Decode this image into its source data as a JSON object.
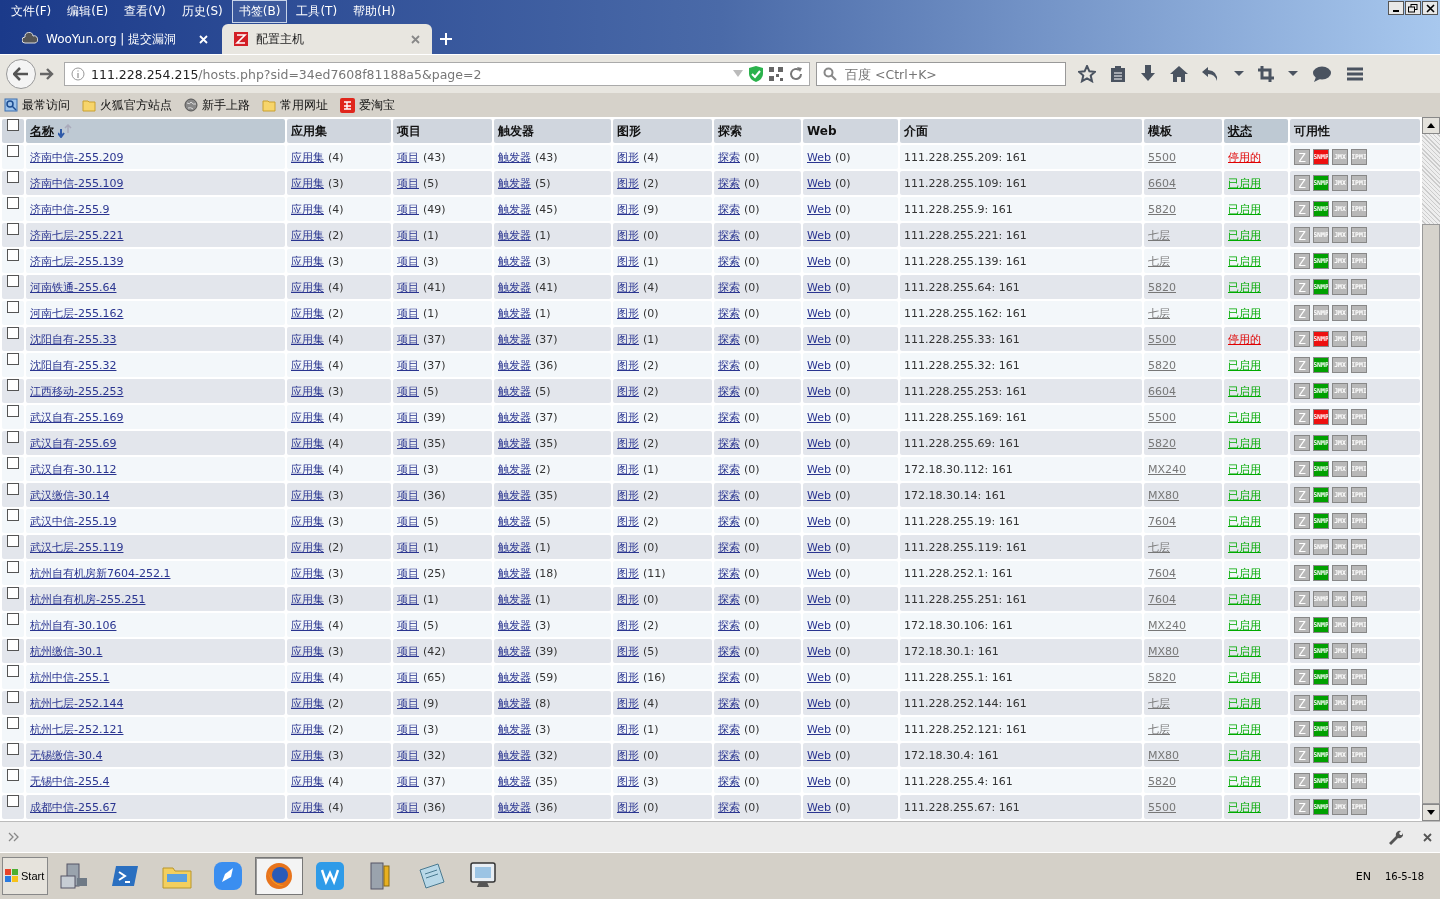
{
  "menu": [
    {
      "label": "文件(F)",
      "selected": false
    },
    {
      "label": "编辑(E)",
      "selected": false
    },
    {
      "label": "查看(V)",
      "selected": false
    },
    {
      "label": "历史(S)",
      "selected": false
    },
    {
      "label": "书签(B)",
      "selected": true
    },
    {
      "label": "工具(T)",
      "selected": false
    },
    {
      "label": "帮助(H)",
      "selected": false
    }
  ],
  "tabs": [
    {
      "title": "WooYun.org | 提交漏洞",
      "selected": false,
      "kind": "cloud"
    },
    {
      "title": "配置主机",
      "selected": true,
      "kind": "zabbix"
    }
  ],
  "address": {
    "host": "111.228.254.215",
    "path": "/hosts.php?sid=34ed7608f81188a5&page=2"
  },
  "search": {
    "placeholder": "百度 <Ctrl+K>"
  },
  "bookmarks": [
    {
      "label": "最常访问",
      "kind": "smart"
    },
    {
      "label": "火狐官方站点",
      "kind": "folder"
    },
    {
      "label": "新手上路",
      "kind": "globe"
    },
    {
      "label": "常用网址",
      "kind": "folder"
    },
    {
      "label": "爱淘宝",
      "kind": "taobao"
    }
  ],
  "table": {
    "header_checked": false,
    "columns": [
      {
        "label": "名称",
        "sortable": true,
        "sorted": true
      },
      {
        "label": "应用集",
        "sortable": false,
        "sorted": false
      },
      {
        "label": "项目",
        "sortable": false,
        "sorted": false
      },
      {
        "label": "触发器",
        "sortable": false,
        "sorted": false
      },
      {
        "label": "图形",
        "sortable": false,
        "sorted": false
      },
      {
        "label": "探索",
        "sortable": false,
        "sorted": false
      },
      {
        "label": "Web",
        "sortable": false,
        "sorted": false
      },
      {
        "label": "介面",
        "sortable": false,
        "sorted": false
      },
      {
        "label": "模板",
        "sortable": false,
        "sorted": false
      },
      {
        "label": "状态",
        "sortable": true,
        "sorted": false
      },
      {
        "label": "可用性",
        "sortable": false,
        "sorted": false
      }
    ],
    "rows": [
      {
        "name": "济南中信-255.209",
        "checked": false,
        "links": [
          [
            "应用集",
            "(4)"
          ],
          [
            "项目",
            "(43)"
          ],
          [
            "触发器",
            "(43)"
          ],
          [
            "图形",
            "(4)"
          ],
          [
            "探索",
            "(0)"
          ],
          [
            "Web",
            "(0)"
          ]
        ],
        "interface": "111.228.255.209: 161",
        "template": "5500",
        "status": {
          "label": "停用的",
          "enabled": false
        },
        "availability": [
          {
            "label": "Z",
            "color": "#b8b8b8"
          },
          {
            "label": "SNMP",
            "color": "#ee1010"
          },
          {
            "label": "JMX",
            "color": "#b8b8b8"
          },
          {
            "label": "IPMI",
            "color": "#b8b8b8"
          }
        ]
      },
      {
        "name": "济南中信-255.109",
        "checked": false,
        "links": [
          [
            "应用集",
            "(3)"
          ],
          [
            "项目",
            "(5)"
          ],
          [
            "触发器",
            "(5)"
          ],
          [
            "图形",
            "(2)"
          ],
          [
            "探索",
            "(0)"
          ],
          [
            "Web",
            "(0)"
          ]
        ],
        "interface": "111.228.255.109: 161",
        "template": "6604",
        "status": {
          "label": "已启用",
          "enabled": true
        },
        "availability": [
          {
            "label": "Z",
            "color": "#b8b8b8"
          },
          {
            "label": "SNMP",
            "color": "#00a000"
          },
          {
            "label": "JMX",
            "color": "#b8b8b8"
          },
          {
            "label": "IPMI",
            "color": "#b8b8b8"
          }
        ]
      },
      {
        "name": "济南中信-255.9",
        "checked": false,
        "links": [
          [
            "应用集",
            "(4)"
          ],
          [
            "项目",
            "(49)"
          ],
          [
            "触发器",
            "(45)"
          ],
          [
            "图形",
            "(9)"
          ],
          [
            "探索",
            "(0)"
          ],
          [
            "Web",
            "(0)"
          ]
        ],
        "interface": "111.228.255.9: 161",
        "template": "5820",
        "status": {
          "label": "已启用",
          "enabled": true
        },
        "availability": [
          {
            "label": "Z",
            "color": "#b8b8b8"
          },
          {
            "label": "SNMP",
            "color": "#00a000"
          },
          {
            "label": "JMX",
            "color": "#b8b8b8"
          },
          {
            "label": "IPMI",
            "color": "#b8b8b8"
          }
        ]
      },
      {
        "name": "济南七层-255.221",
        "checked": false,
        "links": [
          [
            "应用集",
            "(2)"
          ],
          [
            "项目",
            "(1)"
          ],
          [
            "触发器",
            "(1)"
          ],
          [
            "图形",
            "(0)"
          ],
          [
            "探索",
            "(0)"
          ],
          [
            "Web",
            "(0)"
          ]
        ],
        "interface": "111.228.255.221: 161",
        "template": "七层",
        "status": {
          "label": "已启用",
          "enabled": true
        },
        "availability": [
          {
            "label": "Z",
            "color": "#b8b8b8"
          },
          {
            "label": "SNMP",
            "color": "#b8b8b8"
          },
          {
            "label": "JMX",
            "color": "#b8b8b8"
          },
          {
            "label": "IPMI",
            "color": "#b8b8b8"
          }
        ]
      },
      {
        "name": "济南七层-255.139",
        "checked": false,
        "links": [
          [
            "应用集",
            "(3)"
          ],
          [
            "项目",
            "(3)"
          ],
          [
            "触发器",
            "(3)"
          ],
          [
            "图形",
            "(1)"
          ],
          [
            "探索",
            "(0)"
          ],
          [
            "Web",
            "(0)"
          ]
        ],
        "interface": "111.228.255.139: 161",
        "template": "七层",
        "status": {
          "label": "已启用",
          "enabled": true
        },
        "availability": [
          {
            "label": "Z",
            "color": "#b8b8b8"
          },
          {
            "label": "SNMP",
            "color": "#00a000"
          },
          {
            "label": "JMX",
            "color": "#b8b8b8"
          },
          {
            "label": "IPMI",
            "color": "#b8b8b8"
          }
        ]
      },
      {
        "name": "河南铁通-255.64",
        "checked": false,
        "links": [
          [
            "应用集",
            "(4)"
          ],
          [
            "项目",
            "(41)"
          ],
          [
            "触发器",
            "(41)"
          ],
          [
            "图形",
            "(4)"
          ],
          [
            "探索",
            "(0)"
          ],
          [
            "Web",
            "(0)"
          ]
        ],
        "interface": "111.228.255.64: 161",
        "template": "5820",
        "status": {
          "label": "已启用",
          "enabled": true
        },
        "availability": [
          {
            "label": "Z",
            "color": "#b8b8b8"
          },
          {
            "label": "SNMP",
            "color": "#00a000"
          },
          {
            "label": "JMX",
            "color": "#b8b8b8"
          },
          {
            "label": "IPMI",
            "color": "#b8b8b8"
          }
        ]
      },
      {
        "name": "河南七层-255.162",
        "checked": false,
        "links": [
          [
            "应用集",
            "(2)"
          ],
          [
            "项目",
            "(1)"
          ],
          [
            "触发器",
            "(1)"
          ],
          [
            "图形",
            "(0)"
          ],
          [
            "探索",
            "(0)"
          ],
          [
            "Web",
            "(0)"
          ]
        ],
        "interface": "111.228.255.162: 161",
        "template": "七层",
        "status": {
          "label": "已启用",
          "enabled": true
        },
        "availability": [
          {
            "label": "Z",
            "color": "#b8b8b8"
          },
          {
            "label": "SNMP",
            "color": "#b8b8b8"
          },
          {
            "label": "JMX",
            "color": "#b8b8b8"
          },
          {
            "label": "IPMI",
            "color": "#b8b8b8"
          }
        ]
      },
      {
        "name": "沈阳自有-255.33",
        "checked": false,
        "links": [
          [
            "应用集",
            "(4)"
          ],
          [
            "项目",
            "(37)"
          ],
          [
            "触发器",
            "(37)"
          ],
          [
            "图形",
            "(1)"
          ],
          [
            "探索",
            "(0)"
          ],
          [
            "Web",
            "(0)"
          ]
        ],
        "interface": "111.228.255.33: 161",
        "template": "5500",
        "status": {
          "label": "停用的",
          "enabled": false
        },
        "availability": [
          {
            "label": "Z",
            "color": "#b8b8b8"
          },
          {
            "label": "SNMP",
            "color": "#ee1010"
          },
          {
            "label": "JMX",
            "color": "#b8b8b8"
          },
          {
            "label": "IPMI",
            "color": "#b8b8b8"
          }
        ]
      },
      {
        "name": "沈阳自有-255.32",
        "checked": false,
        "links": [
          [
            "应用集",
            "(4)"
          ],
          [
            "项目",
            "(37)"
          ],
          [
            "触发器",
            "(36)"
          ],
          [
            "图形",
            "(2)"
          ],
          [
            "探索",
            "(0)"
          ],
          [
            "Web",
            "(0)"
          ]
        ],
        "interface": "111.228.255.32: 161",
        "template": "5820",
        "status": {
          "label": "已启用",
          "enabled": true
        },
        "availability": [
          {
            "label": "Z",
            "color": "#b8b8b8"
          },
          {
            "label": "SNMP",
            "color": "#00a000"
          },
          {
            "label": "JMX",
            "color": "#b8b8b8"
          },
          {
            "label": "IPMI",
            "color": "#b8b8b8"
          }
        ]
      },
      {
        "name": "江西移动-255.253",
        "checked": false,
        "links": [
          [
            "应用集",
            "(3)"
          ],
          [
            "项目",
            "(5)"
          ],
          [
            "触发器",
            "(5)"
          ],
          [
            "图形",
            "(2)"
          ],
          [
            "探索",
            "(0)"
          ],
          [
            "Web",
            "(0)"
          ]
        ],
        "interface": "111.228.255.253: 161",
        "template": "6604",
        "status": {
          "label": "已启用",
          "enabled": true
        },
        "availability": [
          {
            "label": "Z",
            "color": "#b8b8b8"
          },
          {
            "label": "SNMP",
            "color": "#00a000"
          },
          {
            "label": "JMX",
            "color": "#b8b8b8"
          },
          {
            "label": "IPMI",
            "color": "#b8b8b8"
          }
        ]
      },
      {
        "name": "武汉自有-255.169",
        "checked": false,
        "links": [
          [
            "应用集",
            "(4)"
          ],
          [
            "项目",
            "(39)"
          ],
          [
            "触发器",
            "(37)"
          ],
          [
            "图形",
            "(2)"
          ],
          [
            "探索",
            "(0)"
          ],
          [
            "Web",
            "(0)"
          ]
        ],
        "interface": "111.228.255.169: 161",
        "template": "5500",
        "status": {
          "label": "已启用",
          "enabled": true
        },
        "availability": [
          {
            "label": "Z",
            "color": "#b8b8b8"
          },
          {
            "label": "SNMP",
            "color": "#ee1010"
          },
          {
            "label": "JMX",
            "color": "#b8b8b8"
          },
          {
            "label": "IPMI",
            "color": "#b8b8b8"
          }
        ]
      },
      {
        "name": "武汉自有-255.69",
        "checked": false,
        "links": [
          [
            "应用集",
            "(4)"
          ],
          [
            "项目",
            "(35)"
          ],
          [
            "触发器",
            "(35)"
          ],
          [
            "图形",
            "(2)"
          ],
          [
            "探索",
            "(0)"
          ],
          [
            "Web",
            "(0)"
          ]
        ],
        "interface": "111.228.255.69: 161",
        "template": "5820",
        "status": {
          "label": "已启用",
          "enabled": true
        },
        "availability": [
          {
            "label": "Z",
            "color": "#b8b8b8"
          },
          {
            "label": "SNMP",
            "color": "#00a000"
          },
          {
            "label": "JMX",
            "color": "#b8b8b8"
          },
          {
            "label": "IPMI",
            "color": "#b8b8b8"
          }
        ]
      },
      {
        "name": "武汉自有-30.112",
        "checked": false,
        "links": [
          [
            "应用集",
            "(4)"
          ],
          [
            "项目",
            "(3)"
          ],
          [
            "触发器",
            "(2)"
          ],
          [
            "图形",
            "(1)"
          ],
          [
            "探索",
            "(0)"
          ],
          [
            "Web",
            "(0)"
          ]
        ],
        "interface": "172.18.30.112: 161",
        "template": "MX240",
        "status": {
          "label": "已启用",
          "enabled": true
        },
        "availability": [
          {
            "label": "Z",
            "color": "#b8b8b8"
          },
          {
            "label": "SNMP",
            "color": "#00a000"
          },
          {
            "label": "JMX",
            "color": "#b8b8b8"
          },
          {
            "label": "IPMI",
            "color": "#b8b8b8"
          }
        ]
      },
      {
        "name": "武汉缴信-30.14",
        "checked": false,
        "links": [
          [
            "应用集",
            "(3)"
          ],
          [
            "项目",
            "(36)"
          ],
          [
            "触发器",
            "(35)"
          ],
          [
            "图形",
            "(2)"
          ],
          [
            "探索",
            "(0)"
          ],
          [
            "Web",
            "(0)"
          ]
        ],
        "interface": "172.18.30.14: 161",
        "template": "MX80",
        "status": {
          "label": "已启用",
          "enabled": true
        },
        "availability": [
          {
            "label": "Z",
            "color": "#b8b8b8"
          },
          {
            "label": "SNMP",
            "color": "#00a000"
          },
          {
            "label": "JMX",
            "color": "#b8b8b8"
          },
          {
            "label": "IPMI",
            "color": "#b8b8b8"
          }
        ]
      },
      {
        "name": "武汉中信-255.19",
        "checked": false,
        "links": [
          [
            "应用集",
            "(3)"
          ],
          [
            "项目",
            "(5)"
          ],
          [
            "触发器",
            "(5)"
          ],
          [
            "图形",
            "(2)"
          ],
          [
            "探索",
            "(0)"
          ],
          [
            "Web",
            "(0)"
          ]
        ],
        "interface": "111.228.255.19: 161",
        "template": "7604",
        "status": {
          "label": "已启用",
          "enabled": true
        },
        "availability": [
          {
            "label": "Z",
            "color": "#b8b8b8"
          },
          {
            "label": "SNMP",
            "color": "#00a000"
          },
          {
            "label": "JMX",
            "color": "#b8b8b8"
          },
          {
            "label": "IPMI",
            "color": "#b8b8b8"
          }
        ]
      },
      {
        "name": "武汉七层-255.119",
        "checked": false,
        "links": [
          [
            "应用集",
            "(2)"
          ],
          [
            "项目",
            "(1)"
          ],
          [
            "触发器",
            "(1)"
          ],
          [
            "图形",
            "(0)"
          ],
          [
            "探索",
            "(0)"
          ],
          [
            "Web",
            "(0)"
          ]
        ],
        "interface": "111.228.255.119: 161",
        "template": "七层",
        "status": {
          "label": "已启用",
          "enabled": true
        },
        "availability": [
          {
            "label": "Z",
            "color": "#b8b8b8"
          },
          {
            "label": "SNMP",
            "color": "#b8b8b8"
          },
          {
            "label": "JMX",
            "color": "#b8b8b8"
          },
          {
            "label": "IPMI",
            "color": "#b8b8b8"
          }
        ]
      },
      {
        "name": "杭州自有机房新7604-252.1",
        "checked": false,
        "links": [
          [
            "应用集",
            "(3)"
          ],
          [
            "项目",
            "(25)"
          ],
          [
            "触发器",
            "(18)"
          ],
          [
            "图形",
            "(11)"
          ],
          [
            "探索",
            "(0)"
          ],
          [
            "Web",
            "(0)"
          ]
        ],
        "interface": "111.228.252.1: 161",
        "template": "7604",
        "status": {
          "label": "已启用",
          "enabled": true
        },
        "availability": [
          {
            "label": "Z",
            "color": "#b8b8b8"
          },
          {
            "label": "SNMP",
            "color": "#00a000"
          },
          {
            "label": "JMX",
            "color": "#b8b8b8"
          },
          {
            "label": "IPMI",
            "color": "#b8b8b8"
          }
        ]
      },
      {
        "name": "杭州自有机房-255.251",
        "checked": false,
        "links": [
          [
            "应用集",
            "(3)"
          ],
          [
            "项目",
            "(1)"
          ],
          [
            "触发器",
            "(1)"
          ],
          [
            "图形",
            "(0)"
          ],
          [
            "探索",
            "(0)"
          ],
          [
            "Web",
            "(0)"
          ]
        ],
        "interface": "111.228.255.251: 161",
        "template": "7604",
        "status": {
          "label": "已启用",
          "enabled": true
        },
        "availability": [
          {
            "label": "Z",
            "color": "#b8b8b8"
          },
          {
            "label": "SNMP",
            "color": "#b8b8b8"
          },
          {
            "label": "JMX",
            "color": "#b8b8b8"
          },
          {
            "label": "IPMI",
            "color": "#b8b8b8"
          }
        ]
      },
      {
        "name": "杭州自有-30.106",
        "checked": false,
        "links": [
          [
            "应用集",
            "(4)"
          ],
          [
            "项目",
            "(5)"
          ],
          [
            "触发器",
            "(3)"
          ],
          [
            "图形",
            "(2)"
          ],
          [
            "探索",
            "(0)"
          ],
          [
            "Web",
            "(0)"
          ]
        ],
        "interface": "172.18.30.106: 161",
        "template": "MX240",
        "status": {
          "label": "已启用",
          "enabled": true
        },
        "availability": [
          {
            "label": "Z",
            "color": "#b8b8b8"
          },
          {
            "label": "SNMP",
            "color": "#00a000"
          },
          {
            "label": "JMX",
            "color": "#b8b8b8"
          },
          {
            "label": "IPMI",
            "color": "#b8b8b8"
          }
        ]
      },
      {
        "name": "杭州缴信-30.1",
        "checked": false,
        "links": [
          [
            "应用集",
            "(3)"
          ],
          [
            "项目",
            "(42)"
          ],
          [
            "触发器",
            "(39)"
          ],
          [
            "图形",
            "(5)"
          ],
          [
            "探索",
            "(0)"
          ],
          [
            "Web",
            "(0)"
          ]
        ],
        "interface": "172.18.30.1: 161",
        "template": "MX80",
        "status": {
          "label": "已启用",
          "enabled": true
        },
        "availability": [
          {
            "label": "Z",
            "color": "#b8b8b8"
          },
          {
            "label": "SNMP",
            "color": "#00a000"
          },
          {
            "label": "JMX",
            "color": "#b8b8b8"
          },
          {
            "label": "IPMI",
            "color": "#b8b8b8"
          }
        ]
      },
      {
        "name": "杭州中信-255.1",
        "checked": false,
        "links": [
          [
            "应用集",
            "(4)"
          ],
          [
            "项目",
            "(65)"
          ],
          [
            "触发器",
            "(59)"
          ],
          [
            "图形",
            "(16)"
          ],
          [
            "探索",
            "(0)"
          ],
          [
            "Web",
            "(0)"
          ]
        ],
        "interface": "111.228.255.1: 161",
        "template": "5820",
        "status": {
          "label": "已启用",
          "enabled": true
        },
        "availability": [
          {
            "label": "Z",
            "color": "#b8b8b8"
          },
          {
            "label": "SNMP",
            "color": "#00a000"
          },
          {
            "label": "JMX",
            "color": "#b8b8b8"
          },
          {
            "label": "IPMI",
            "color": "#b8b8b8"
          }
        ]
      },
      {
        "name": "杭州七层-252.144",
        "checked": false,
        "links": [
          [
            "应用集",
            "(2)"
          ],
          [
            "项目",
            "(9)"
          ],
          [
            "触发器",
            "(8)"
          ],
          [
            "图形",
            "(4)"
          ],
          [
            "探索",
            "(0)"
          ],
          [
            "Web",
            "(0)"
          ]
        ],
        "interface": "111.228.252.144: 161",
        "template": "七层",
        "status": {
          "label": "已启用",
          "enabled": true
        },
        "availability": [
          {
            "label": "Z",
            "color": "#b8b8b8"
          },
          {
            "label": "SNMP",
            "color": "#00a000"
          },
          {
            "label": "JMX",
            "color": "#b8b8b8"
          },
          {
            "label": "IPMI",
            "color": "#b8b8b8"
          }
        ]
      },
      {
        "name": "杭州七层-252.121",
        "checked": false,
        "links": [
          [
            "应用集",
            "(2)"
          ],
          [
            "项目",
            "(3)"
          ],
          [
            "触发器",
            "(3)"
          ],
          [
            "图形",
            "(1)"
          ],
          [
            "探索",
            "(0)"
          ],
          [
            "Web",
            "(0)"
          ]
        ],
        "interface": "111.228.252.121: 161",
        "template": "七层",
        "status": {
          "label": "已启用",
          "enabled": true
        },
        "availability": [
          {
            "label": "Z",
            "color": "#b8b8b8"
          },
          {
            "label": "SNMP",
            "color": "#00a000"
          },
          {
            "label": "JMX",
            "color": "#b8b8b8"
          },
          {
            "label": "IPMI",
            "color": "#b8b8b8"
          }
        ]
      },
      {
        "name": "无锡缴信-30.4",
        "checked": false,
        "links": [
          [
            "应用集",
            "(3)"
          ],
          [
            "项目",
            "(32)"
          ],
          [
            "触发器",
            "(32)"
          ],
          [
            "图形",
            "(0)"
          ],
          [
            "探索",
            "(0)"
          ],
          [
            "Web",
            "(0)"
          ]
        ],
        "interface": "172.18.30.4: 161",
        "template": "MX80",
        "status": {
          "label": "已启用",
          "enabled": true
        },
        "availability": [
          {
            "label": "Z",
            "color": "#b8b8b8"
          },
          {
            "label": "SNMP",
            "color": "#00a000"
          },
          {
            "label": "JMX",
            "color": "#b8b8b8"
          },
          {
            "label": "IPMI",
            "color": "#b8b8b8"
          }
        ]
      },
      {
        "name": "无锡中信-255.4",
        "checked": false,
        "links": [
          [
            "应用集",
            "(4)"
          ],
          [
            "项目",
            "(37)"
          ],
          [
            "触发器",
            "(35)"
          ],
          [
            "图形",
            "(3)"
          ],
          [
            "探索",
            "(0)"
          ],
          [
            "Web",
            "(0)"
          ]
        ],
        "interface": "111.228.255.4: 161",
        "template": "5820",
        "status": {
          "label": "已启用",
          "enabled": true
        },
        "availability": [
          {
            "label": "Z",
            "color": "#b8b8b8"
          },
          {
            "label": "SNMP",
            "color": "#00a000"
          },
          {
            "label": "JMX",
            "color": "#b8b8b8"
          },
          {
            "label": "IPMI",
            "color": "#b8b8b8"
          }
        ]
      },
      {
        "name": "成都中信-255.67",
        "checked": false,
        "links": [
          [
            "应用集",
            "(4)"
          ],
          [
            "项目",
            "(36)"
          ],
          [
            "触发器",
            "(36)"
          ],
          [
            "图形",
            "(0)"
          ],
          [
            "探索",
            "(0)"
          ],
          [
            "Web",
            "(0)"
          ]
        ],
        "interface": "111.228.255.67: 161",
        "template": "5500",
        "status": {
          "label": "已启用",
          "enabled": true
        },
        "availability": [
          {
            "label": "Z",
            "color": "#b8b8b8"
          },
          {
            "label": "SNMP",
            "color": "#00a000"
          },
          {
            "label": "JMX",
            "color": "#b8b8b8"
          },
          {
            "label": "IPMI",
            "color": "#b8b8b8"
          }
        ]
      }
    ]
  },
  "taskbar": {
    "start": "Start",
    "apps": [
      {
        "kind": "server",
        "selected": false
      },
      {
        "kind": "shell",
        "selected": false
      },
      {
        "kind": "explorer",
        "selected": false
      },
      {
        "kind": "feather",
        "selected": false
      },
      {
        "kind": "firefox",
        "selected": true
      },
      {
        "kind": "wps",
        "selected": false
      },
      {
        "kind": "tools",
        "selected": false
      },
      {
        "kind": "notepad",
        "selected": false
      },
      {
        "kind": "monitor",
        "selected": false
      }
    ],
    "language": "EN",
    "date": "16-5-18"
  }
}
